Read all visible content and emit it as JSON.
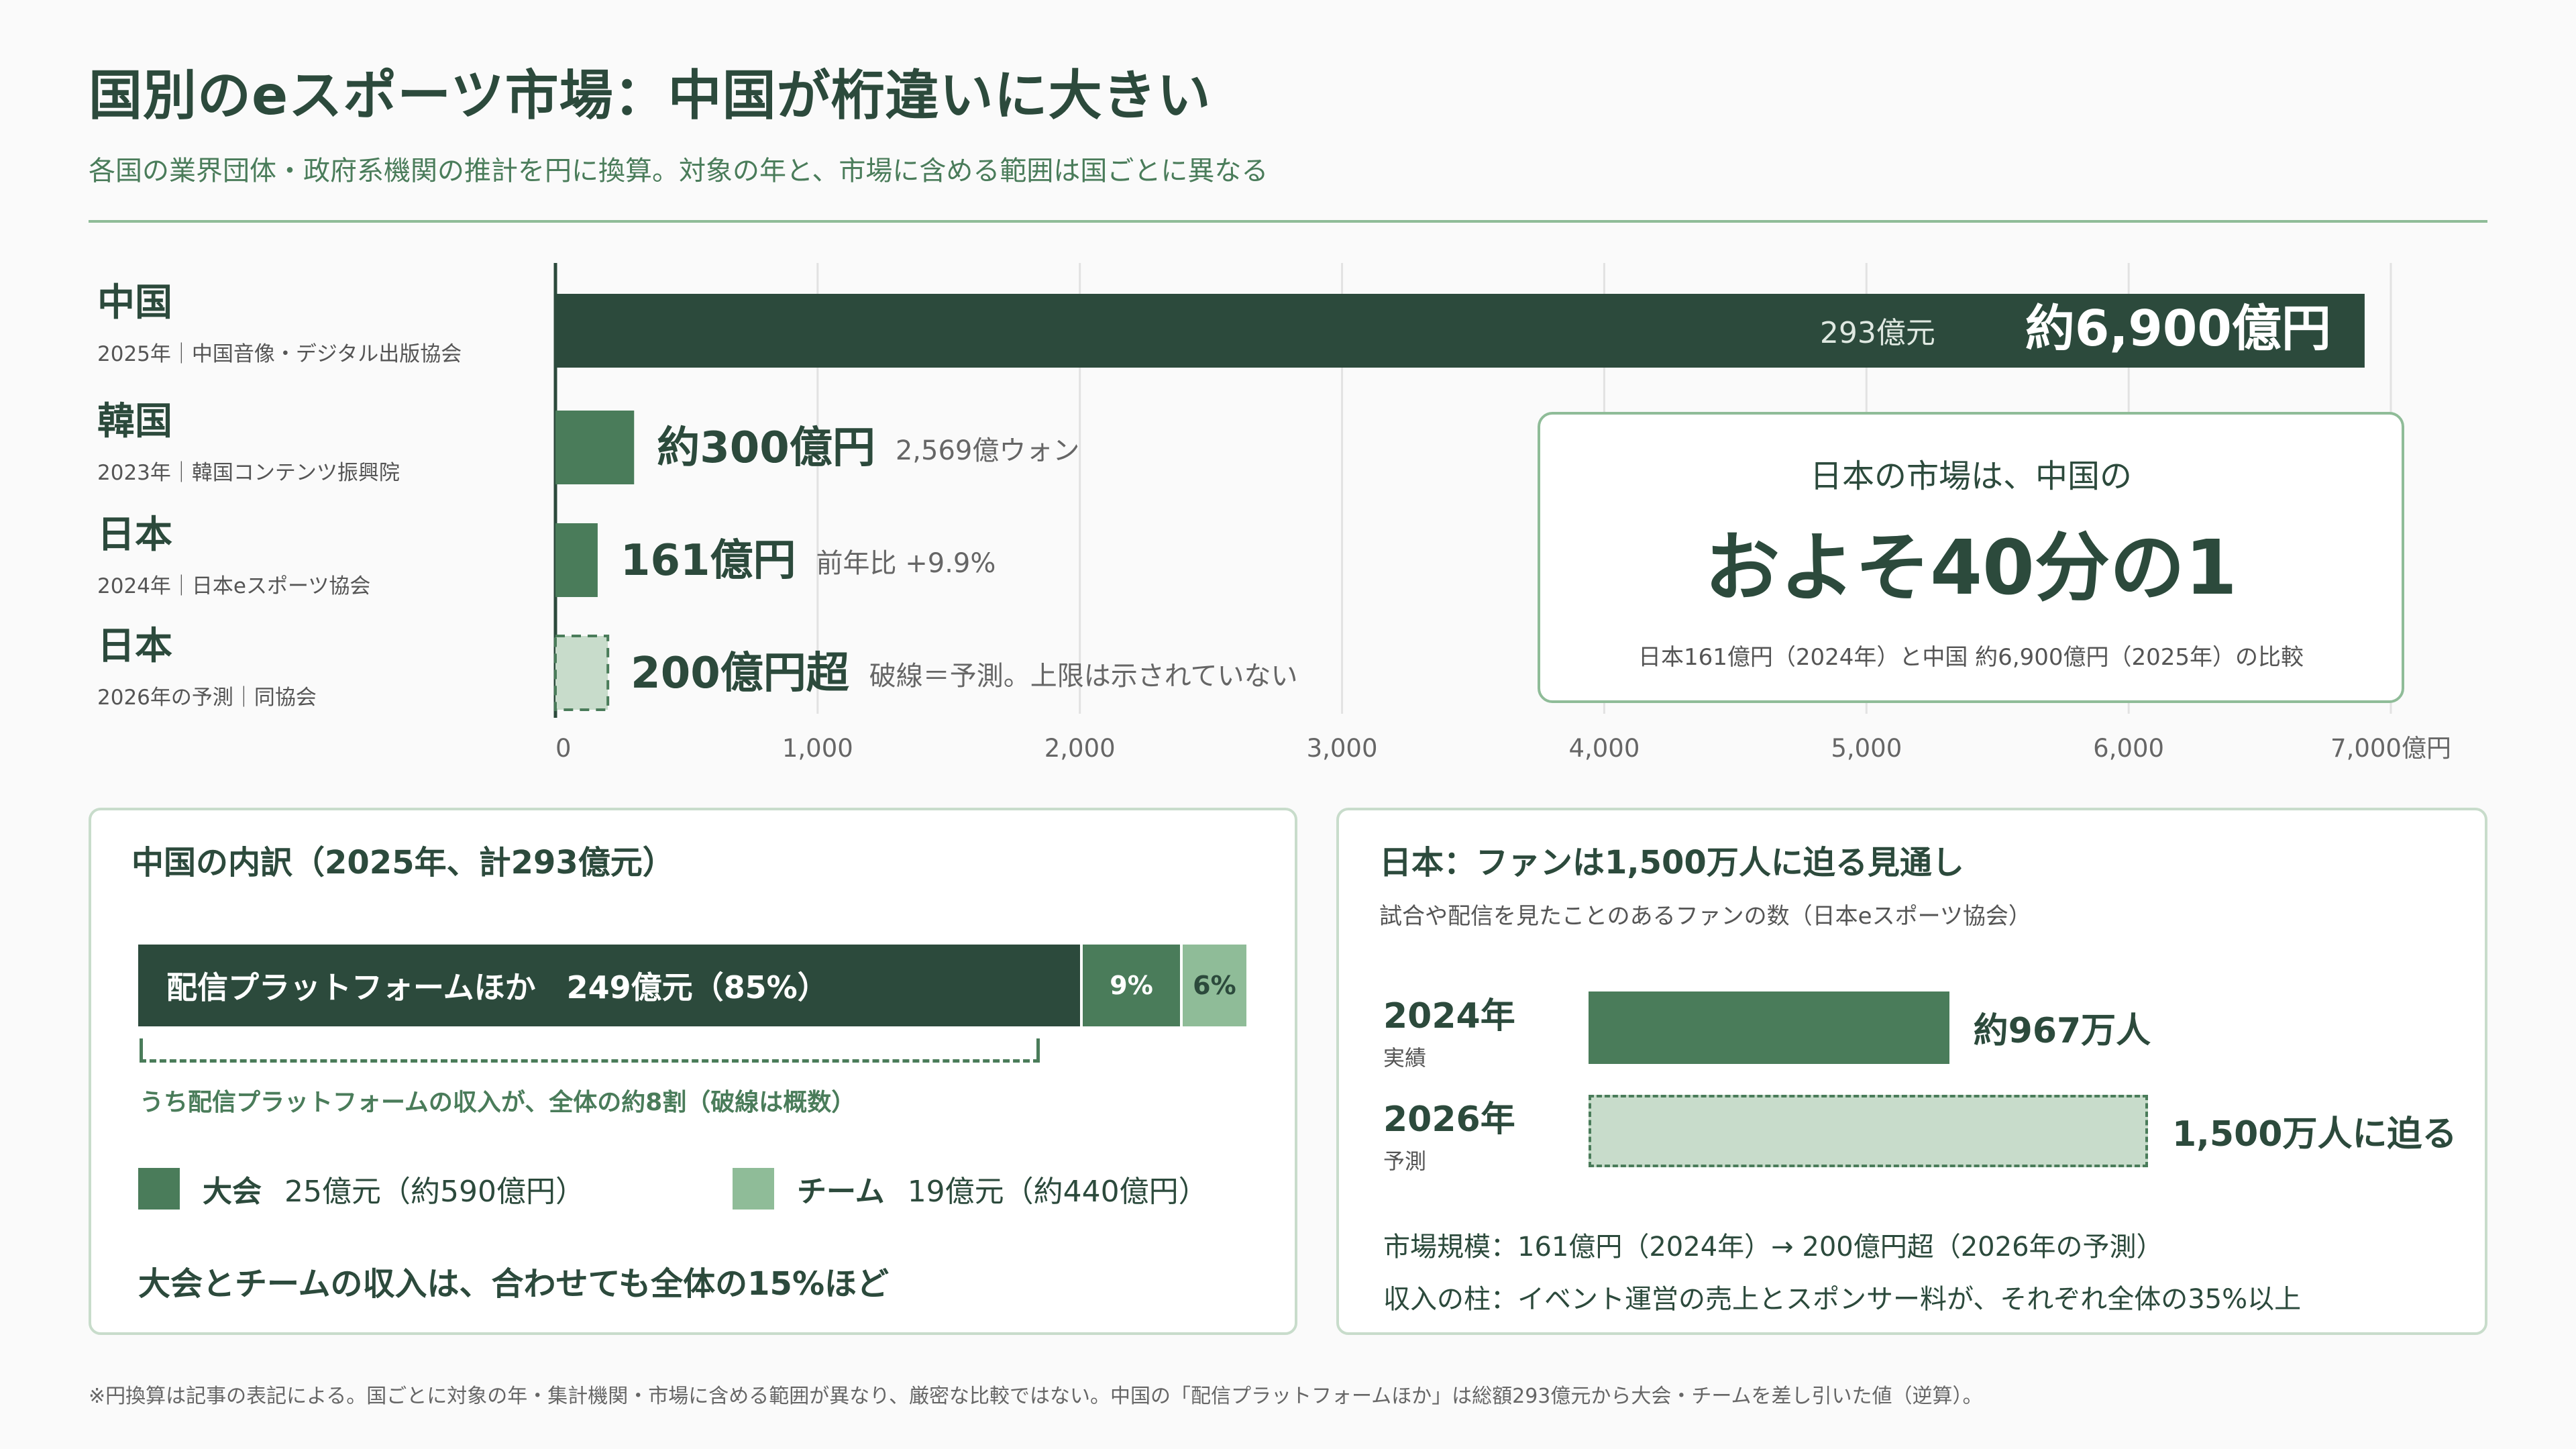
{
  "title": "国別のeスポーツ市場：中国が桁違いに大きい",
  "subtitle": "各国の業界団体・政府系機関の推計を円に換算。対象の年と、市場に含める範囲は国ごとに異なる",
  "rows": [
    {
      "name": "中国",
      "source": "2025年｜中国音像・デジタル出版協会"
    },
    {
      "name": "韓国",
      "source": "2023年｜韓国コンテンツ振興院"
    },
    {
      "name": "日本",
      "source": "2024年｜日本eスポーツ協会"
    },
    {
      "name": "日本",
      "source": "2026年の予測｜同協会"
    }
  ],
  "chart_data": {
    "type": "bar",
    "orientation": "horizontal",
    "categories": [
      "中国",
      "韓国",
      "日本",
      "日本"
    ],
    "values": [
      6900,
      300,
      161,
      200
    ],
    "value_labels": [
      "約6,900億円",
      "約300億円",
      "161億円",
      "200億円超"
    ],
    "notes": [
      "293億元",
      "2,569億ウォン",
      "前年比 +9.9%",
      "破線＝予測。上限は示されていない"
    ],
    "styles": [
      "dark",
      "medium",
      "medium",
      "forecast-dashed"
    ],
    "xlim": [
      0,
      7000
    ],
    "ticks": [
      0,
      1000,
      2000,
      3000,
      4000,
      5000,
      6000,
      7000
    ],
    "tick_labels": [
      "0",
      "1,000",
      "2,000",
      "3,000",
      "4,000",
      "5,000",
      "6,000",
      "7,000億円"
    ],
    "grid": true,
    "colors": {
      "dark": "#2c4a3c",
      "medium": "#4a7c5a",
      "light": "#8fbc98",
      "forecast": "#c8dccb"
    }
  },
  "callout": {
    "line1": "日本の市場は、中国の",
    "line2": "およそ40分の1",
    "line3": "日本161億円（2024年）と中国 約6,900億円（2025年）の比較"
  },
  "china_breakdown": {
    "title": "中国の内訳（2025年、計293億元）",
    "segments": [
      {
        "label": "配信プラットフォームほか　249億元（85%）",
        "share": 85
      },
      {
        "label": "9%",
        "share": 9
      },
      {
        "label": "6%",
        "share": 6
      }
    ],
    "bracket_note": "うち配信プラットフォームの収入が、全体の約8割（破線は概数）",
    "legend": [
      {
        "name": "大会",
        "value": "25億元（約590億円）",
        "color": "#4a7c5a"
      },
      {
        "name": "チーム",
        "value": "19億元（約440億円）",
        "color": "#8fbc98"
      }
    ],
    "footer": "大会とチームの収入は、合わせても全体の15%ほど"
  },
  "japan_fans": {
    "title": "日本：ファンは1,500万人に迫る見通し",
    "subtitle": "試合や配信を見たことのあるファンの数（日本eスポーツ協会）",
    "rows": [
      {
        "year": "2024年",
        "kind": "実績",
        "value": 967,
        "label": "約967万人"
      },
      {
        "year": "2026年",
        "kind": "予測",
        "value": 1500,
        "label": "1,500万人に迫る"
      }
    ],
    "note1": "市場規模：161億円（2024年）→ 200億円超（2026年の予測）",
    "note2": "収入の柱：イベント運営の売上とスポンサー料が、それぞれ全体の35%以上"
  },
  "footnote": "※円換算は記事の表記による。国ごとに対象の年・集計機関・市場に含める範囲が異なり、厳密な比較ではない。中国の「配信プラットフォームほか」は総額293億元から大会・チームを差し引いた値（逆算）。"
}
